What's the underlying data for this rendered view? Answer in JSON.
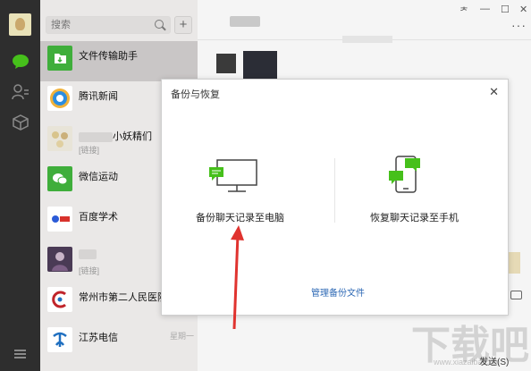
{
  "search": {
    "placeholder": "搜索",
    "add_label": "+"
  },
  "chats": [
    {
      "name": "文件传输助手",
      "sub": "",
      "time": "",
      "color": "#3fae3b"
    },
    {
      "name": "腾讯新闻",
      "sub": "",
      "time": "",
      "color": "#ffffff"
    },
    {
      "name": "小妖精们",
      "sub": "[链接]",
      "time": "",
      "color": "#e8e4d8"
    },
    {
      "name": "微信运动",
      "sub": "",
      "time": "",
      "color": "#3fae3b"
    },
    {
      "name": "百度学术",
      "sub": "",
      "time": "",
      "color": "#ffffff"
    },
    {
      "name": "",
      "sub": "[链接]",
      "time": "",
      "color": "#4a3a55"
    },
    {
      "name": "常州市第二人民医院",
      "sub": "",
      "time": "",
      "color": "#ffffff"
    },
    {
      "name": "江苏电信",
      "sub": "",
      "time": "星期一",
      "color": "#ffffff"
    }
  ],
  "window": {
    "pin": "ᅔ",
    "minimize": "—",
    "maximize": "☐",
    "close": "✕",
    "more": "···"
  },
  "dialog": {
    "title": "备份与恢复",
    "close": "✕",
    "backup_label": "备份聊天记录至电脑",
    "restore_label": "恢复聊天记录至手机",
    "manage_link": "管理备份文件"
  },
  "composer": {
    "send_label": "发送(S)"
  },
  "watermark": {
    "text": "下载吧",
    "sub": "www.xiazaiba.com"
  },
  "colors": {
    "accent_green": "#46c01b",
    "link_blue": "#2e69b5",
    "arrow_red": "#e0332f"
  }
}
